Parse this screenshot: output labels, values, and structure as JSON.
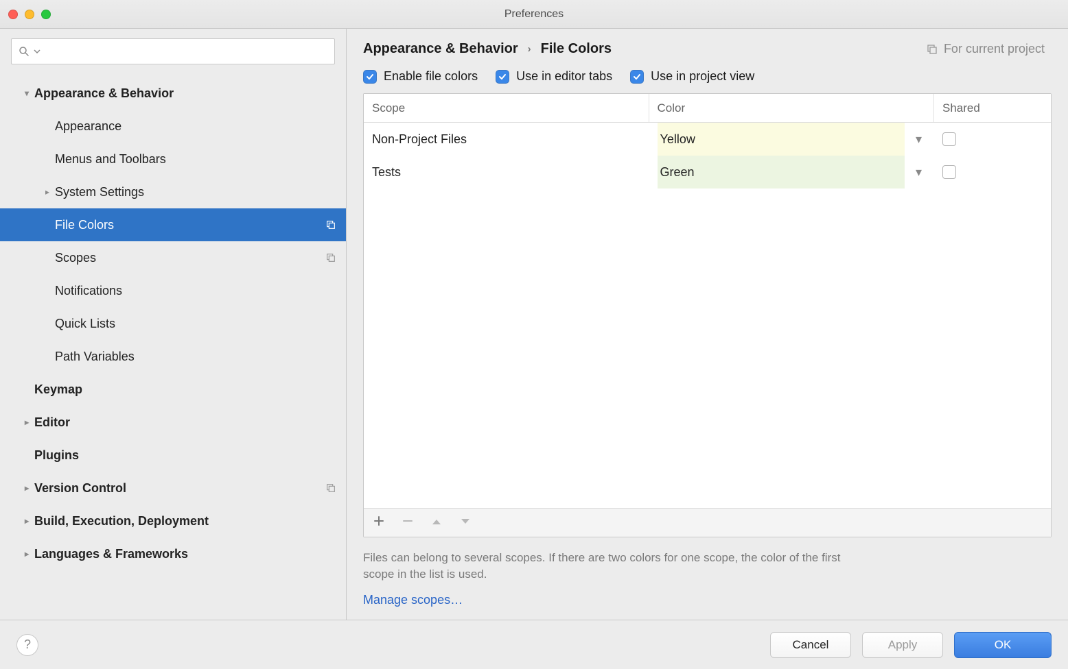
{
  "window": {
    "title": "Preferences"
  },
  "search": {
    "placeholder": ""
  },
  "sidebar": {
    "items": [
      {
        "label": "Appearance & Behavior",
        "level": 0,
        "arrow": "down",
        "selected": false,
        "badge": false
      },
      {
        "label": "Appearance",
        "level": 1,
        "arrow": "",
        "selected": false,
        "badge": false
      },
      {
        "label": "Menus and Toolbars",
        "level": 1,
        "arrow": "",
        "selected": false,
        "badge": false
      },
      {
        "label": "System Settings",
        "level": 1,
        "arrow": "right",
        "selected": false,
        "badge": false
      },
      {
        "label": "File Colors",
        "level": 1,
        "arrow": "",
        "selected": true,
        "badge": true
      },
      {
        "label": "Scopes",
        "level": 1,
        "arrow": "",
        "selected": false,
        "badge": true
      },
      {
        "label": "Notifications",
        "level": 1,
        "arrow": "",
        "selected": false,
        "badge": false
      },
      {
        "label": "Quick Lists",
        "level": 1,
        "arrow": "",
        "selected": false,
        "badge": false
      },
      {
        "label": "Path Variables",
        "level": 1,
        "arrow": "",
        "selected": false,
        "badge": false
      },
      {
        "label": "Keymap",
        "level": 0,
        "arrow": "",
        "selected": false,
        "badge": false
      },
      {
        "label": "Editor",
        "level": 0,
        "arrow": "right",
        "selected": false,
        "badge": false
      },
      {
        "label": "Plugins",
        "level": 0,
        "arrow": "",
        "selected": false,
        "badge": false
      },
      {
        "label": "Version Control",
        "level": 0,
        "arrow": "right",
        "selected": false,
        "badge": true
      },
      {
        "label": "Build, Execution, Deployment",
        "level": 0,
        "arrow": "right",
        "selected": false,
        "badge": false
      },
      {
        "label": "Languages & Frameworks",
        "level": 0,
        "arrow": "right",
        "selected": false,
        "badge": false
      }
    ]
  },
  "header": {
    "crumb0": "Appearance & Behavior",
    "crumb1": "File Colors",
    "project_tag": "For current project"
  },
  "checks": {
    "enable": "Enable file colors",
    "tabs": "Use in editor tabs",
    "project": "Use in project view"
  },
  "table": {
    "headers": {
      "scope": "Scope",
      "color": "Color",
      "shared": "Shared"
    },
    "rows": [
      {
        "scope": "Non-Project Files",
        "color": "Yellow",
        "swatch": "color-yellow",
        "shared": false
      },
      {
        "scope": "Tests",
        "color": "Green",
        "swatch": "color-green",
        "shared": false
      }
    ]
  },
  "hint": "Files can belong to several scopes. If there are two colors for one scope, the color of the first scope in the list is used.",
  "link": "Manage scopes…",
  "footer": {
    "cancel": "Cancel",
    "apply": "Apply",
    "ok": "OK"
  }
}
